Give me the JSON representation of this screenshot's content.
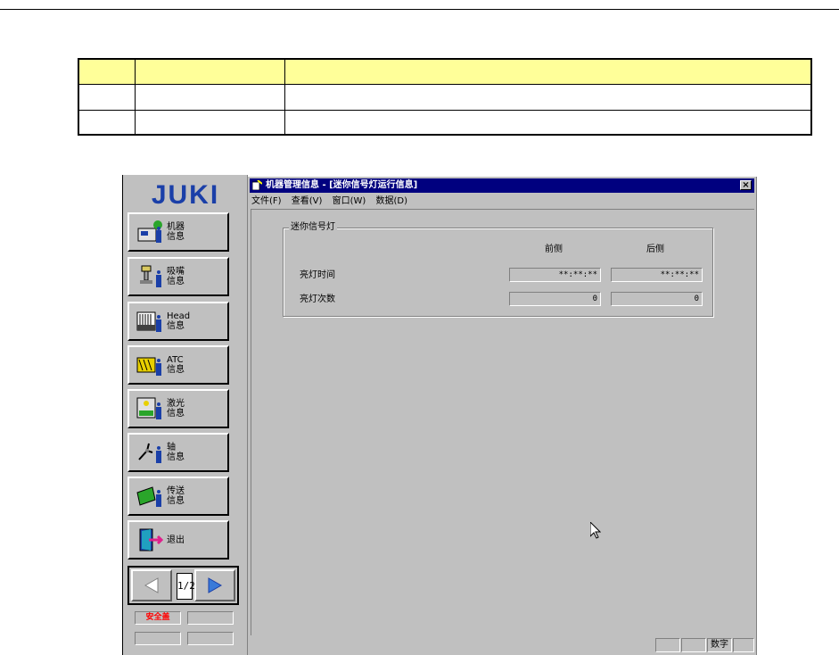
{
  "window": {
    "title": "机器管理信息 - [迷你信号灯运行信息]",
    "close_label": "×"
  },
  "menu": [
    "文件(F)",
    "查看(V)",
    "窗口(W)",
    "数据(D)"
  ],
  "group": {
    "title": "迷你信号灯",
    "col_front": "前侧",
    "col_rear": "后侧",
    "rows": [
      {
        "label": "亮灯时间",
        "front": "**:**:**",
        "rear": "**:**:**"
      },
      {
        "label": "亮灯次数",
        "front": "0",
        "rear": "0"
      }
    ]
  },
  "sidebar": {
    "logo": "JUKI",
    "buttons": [
      {
        "label": "机器\n信息",
        "icon": "machine-info-icon"
      },
      {
        "label": "吸嘴\n信息",
        "icon": "nozzle-info-icon"
      },
      {
        "label": "Head\n信息",
        "icon": "head-info-icon"
      },
      {
        "label": "ATC\n信息",
        "icon": "atc-info-icon"
      },
      {
        "label": "激光\n信息",
        "icon": "laser-info-icon"
      },
      {
        "label": "轴\n信息",
        "icon": "axis-info-icon"
      },
      {
        "label": "传送\n信息",
        "icon": "conveyor-info-icon"
      },
      {
        "label": "退出",
        "icon": "exit-door-icon"
      }
    ],
    "page_indicator": "1/2",
    "status_cells": [
      "安全盖",
      "",
      "",
      ""
    ]
  },
  "statusbar": {
    "num_indicator": "数字"
  },
  "colors": {
    "titlebar": "#00007f",
    "face": "#c0c0c0",
    "table_header": "#ffff99",
    "safety_text": "#ff0000"
  }
}
